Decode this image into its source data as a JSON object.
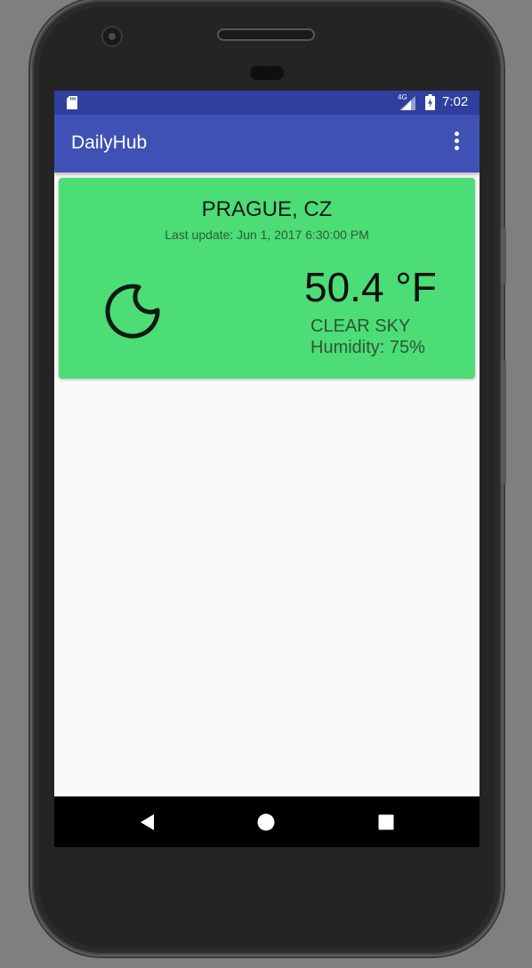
{
  "status_bar": {
    "network_label": "4G",
    "time": "7:02"
  },
  "app_bar": {
    "title": "DailyHub",
    "overflow_icon": "more-vert-icon"
  },
  "weather_card": {
    "city": "PRAGUE, CZ",
    "last_update": "Last update: Jun 1, 2017 6:30:00 PM",
    "temperature": "50.4 °F",
    "condition": "CLEAR SKY",
    "humidity": "Humidity: 75%",
    "icon": "moon-clear-night-icon",
    "card_color": "#4cdd76"
  },
  "nav_bar": {
    "back_icon": "back-triangle-icon",
    "home_icon": "home-circle-icon",
    "recents_icon": "recents-square-icon"
  },
  "colors": {
    "status_bar": "#303f9f",
    "app_bar": "#3f51b5",
    "background": "#fafafa"
  }
}
